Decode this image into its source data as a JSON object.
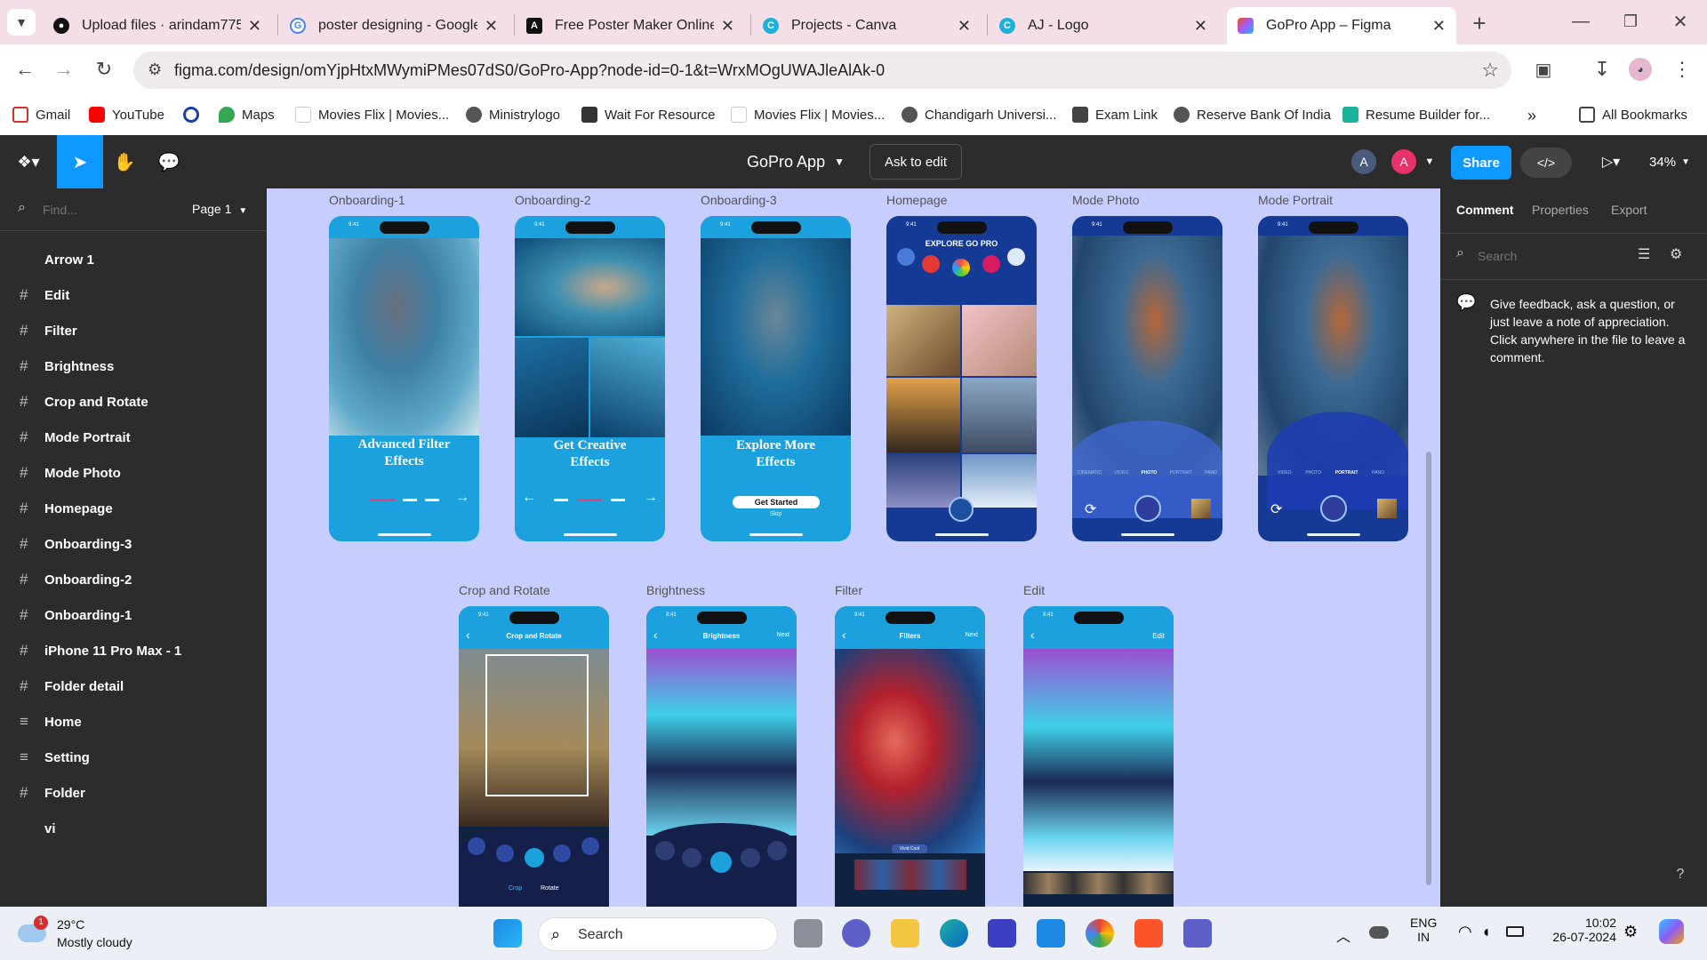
{
  "browser": {
    "tabs": [
      {
        "label": "Upload files · arindam7757",
        "icon": "github-icon",
        "active": false
      },
      {
        "label": "poster designing - Google",
        "icon": "google-icon",
        "active": false
      },
      {
        "label": "Free Poster Maker Online |",
        "icon": "adobe-icon",
        "active": false
      },
      {
        "label": "Projects - Canva",
        "icon": "canva-icon",
        "active": false
      },
      {
        "label": "AJ - Logo",
        "icon": "canva-icon",
        "active": false
      },
      {
        "label": "GoPro App – Figma",
        "icon": "figma-icon",
        "active": true
      }
    ],
    "url": "figma.com/design/omYjpHtxMWymiPMes07dS0/GoPro-App?node-id=0-1&t=WrxMOgUWAJleAlAk-0",
    "bookmarks": [
      "Gmail",
      "YouTube",
      "",
      "Maps",
      "Movies Flix | Movies...",
      "Ministrylogo",
      "Wait For Resource",
      "Movies Flix | Movies...",
      "Chandigarh Universi...",
      "Exam Link",
      "Reserve Bank Of India",
      "Resume Builder for..."
    ],
    "all_bookmarks": "All Bookmarks"
  },
  "figma": {
    "file_title": "GoPro App",
    "ask_to_edit": "Ask to edit",
    "share": "Share",
    "zoom": "34%",
    "avatar_1": "A",
    "avatar_2": "A",
    "find_placeholder": "Find...",
    "page_selector": "Page 1",
    "layers": [
      {
        "name": "Arrow 1",
        "icon": "none"
      },
      {
        "name": "Edit",
        "icon": "frame"
      },
      {
        "name": "Filter",
        "icon": "frame"
      },
      {
        "name": "Brightness",
        "icon": "frame"
      },
      {
        "name": "Crop and Rotate",
        "icon": "frame"
      },
      {
        "name": "Mode Portrait",
        "icon": "frame"
      },
      {
        "name": "Mode Photo",
        "icon": "frame"
      },
      {
        "name": "Homepage",
        "icon": "frame"
      },
      {
        "name": "Onboarding-3",
        "icon": "frame"
      },
      {
        "name": "Onboarding-2",
        "icon": "frame"
      },
      {
        "name": "Onboarding-1",
        "icon": "frame"
      },
      {
        "name": "iPhone 11 Pro Max - 1",
        "icon": "frame"
      },
      {
        "name": "Folder detail",
        "icon": "frame"
      },
      {
        "name": "Home",
        "icon": "list"
      },
      {
        "name": "Setting",
        "icon": "list"
      },
      {
        "name": "Folder",
        "icon": "frame"
      },
      {
        "name": "vi",
        "icon": "none"
      }
    ],
    "right_tabs": [
      "Comment",
      "Properties",
      "Export"
    ],
    "search_placeholder": "Search",
    "comment_hint": "Give feedback, ask a question, or just leave a note of appreciation. Click anywhere in the file to leave a comment.",
    "help": "?"
  },
  "frames": {
    "onboarding1": {
      "label": "Onboarding-1",
      "title_l1": "Advanced Filter",
      "title_l2": "Effects"
    },
    "onboarding2": {
      "label": "Onboarding-2",
      "title_l1": "Get Creative",
      "title_l2": "Effects"
    },
    "onboarding3": {
      "label": "Onboarding-3",
      "title_l1": "Explore More",
      "title_l2": "Effects",
      "button": "Get Started",
      "skip": "Skip"
    },
    "homepage": {
      "label": "Homepage",
      "heading": "EXPLORE GO PRO"
    },
    "mode_photo": {
      "label": "Mode Photo",
      "modes": [
        "CINEMATIC",
        "VIDEO",
        "PHOTO",
        "PORTRAIT",
        "PANO"
      ]
    },
    "mode_portrait": {
      "label": "Mode Portrait",
      "modes": [
        "VIDEO",
        "PHOTO",
        "PORTRAIT",
        "PANO"
      ]
    },
    "crop": {
      "label": "Crop and Rotate",
      "header": "Crop and Rotate",
      "tab_crop": "Crop",
      "tab_rotate": "Rotate"
    },
    "brightness": {
      "label": "Brightness",
      "header": "Brightness",
      "next": "Next"
    },
    "filter": {
      "label": "Filter",
      "header": "Filters",
      "next": "Next",
      "chip": "Vivid Cool"
    },
    "edit": {
      "label": "Edit",
      "next": "Edit"
    },
    "status_time": "9:41"
  },
  "taskbar": {
    "temperature": "29°C",
    "weather": "Mostly cloudy",
    "weather_badge": "1",
    "search": "Search",
    "lang_1": "ENG",
    "lang_2": "IN",
    "time": "10:02",
    "date": "26-07-2024"
  }
}
